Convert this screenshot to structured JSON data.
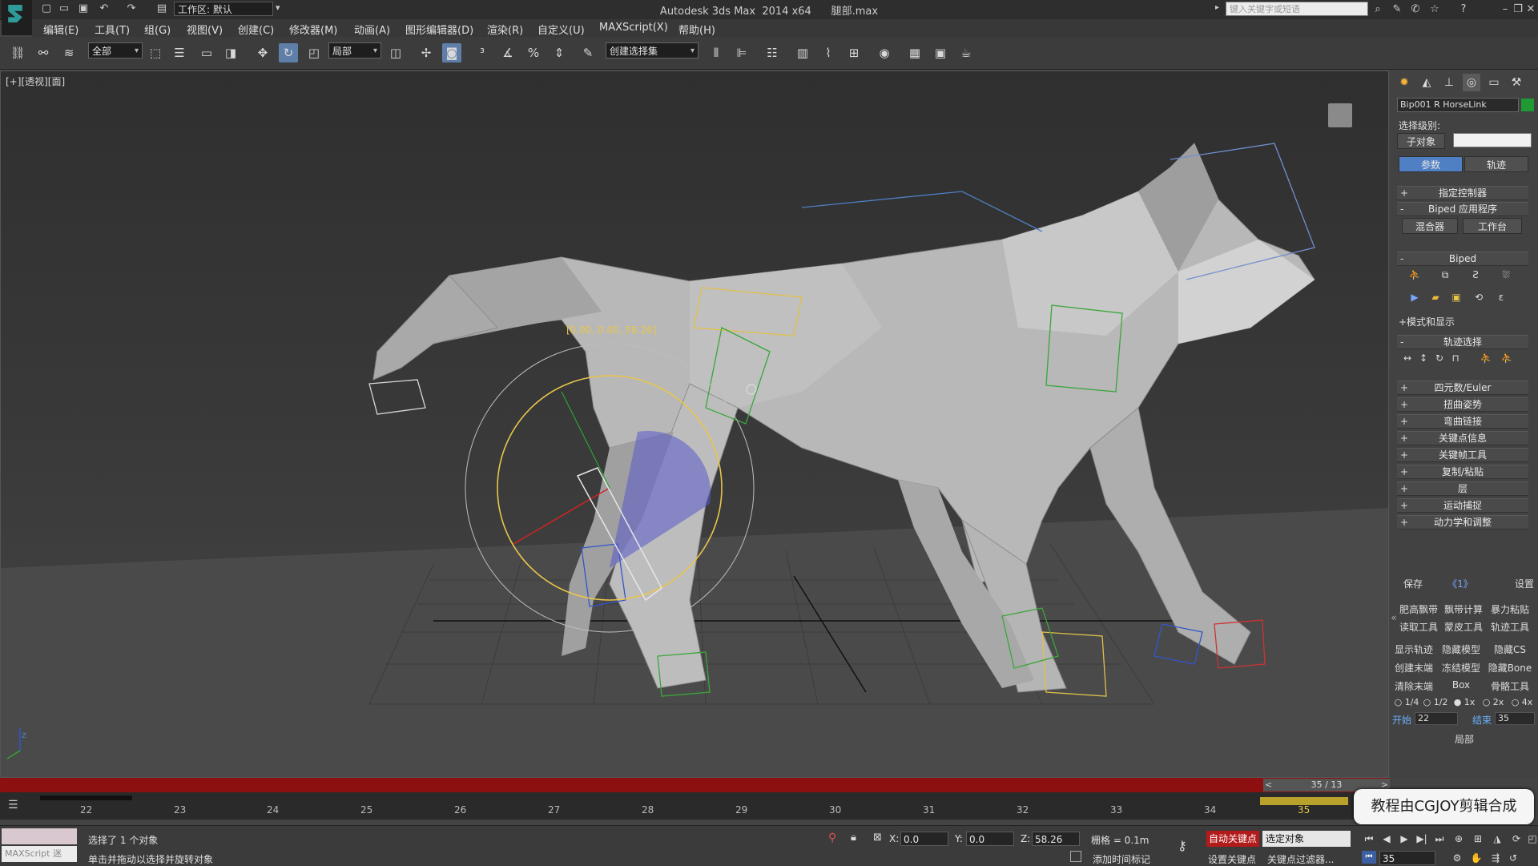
{
  "titlebar": {
    "workspace": "工作区: 默认",
    "window_title": "Autodesk 3ds Max  2014 x64      腿部.max",
    "search_placeholder": "键入关键字或短语"
  },
  "menu": [
    "编辑(E)",
    "工具(T)",
    "组(G)",
    "视图(V)",
    "创建(C)",
    "修改器(M)",
    "动画(A)",
    "图形编辑器(D)",
    "渲染(R)",
    "自定义(U)",
    "MAXScript(X)",
    "帮助(H)"
  ],
  "toolbar": {
    "selection_filter": "全部",
    "ref_coord": "局部",
    "named_selection": "创建选择集"
  },
  "viewport": {
    "label": "[+][透视][面]",
    "gizmo_readout": "[0.00, 0.00, 58.26]",
    "axis_z": "z"
  },
  "command_panel": {
    "object_name": "Bip001 R HorseLink",
    "selection_level_label": "选择级别:",
    "sub_object": "子对象",
    "tab_params": "参数",
    "tab_track": "轨迹",
    "rollouts_top": [
      "指定控制器",
      "Biped 应用程序"
    ],
    "mixer": "混合器",
    "workbench": "工作台",
    "biped_rollout": "Biped",
    "mode_display": "+模式和显示",
    "track_selection": "轨迹选择",
    "rollouts_bottom": [
      "四元数/Euler",
      "扭曲姿势",
      "弯曲链接",
      "关键点信息",
      "关键帧工具",
      "复制/粘贴",
      "层",
      "运动捕捉",
      "动力学和调整"
    ],
    "save": "保存",
    "page": "《1》",
    "settings": "设置",
    "grid_buttons": [
      [
        "肥高飘带",
        "飘带计算",
        "暴力粘贴"
      ],
      [
        "读取工具",
        "蒙皮工具",
        "轨迹工具"
      ],
      [
        "显示轨迹",
        "隐藏模型",
        "隐藏CS"
      ],
      [
        "创建末端",
        "冻结模型",
        "隐藏Bone"
      ],
      [
        "清除末端",
        "Box",
        "骨骼工具"
      ]
    ],
    "speed_options": [
      "1/4",
      "1/2",
      "1x",
      "2x",
      "4x"
    ],
    "start_label": "开始",
    "start_value": "22",
    "end_label": "结束",
    "end_value": "35",
    "local_label": "局部"
  },
  "timeline": {
    "slider": "35 / 13",
    "ticks": [
      "22",
      "23",
      "24",
      "25",
      "26",
      "27",
      "28",
      "29",
      "30",
      "31",
      "32",
      "33",
      "34",
      "35"
    ]
  },
  "watermark": "教程由CGJOY剪辑合成",
  "status": {
    "maxscript_label": "MAXScript 迷",
    "selected_text": "选择了 1 个对象",
    "prompt_text": "单击并拖动以选择并旋转对象",
    "x_label": "X:",
    "x_value": "0.0",
    "y_label": "Y:",
    "y_value": "0.0",
    "z_label": "Z:",
    "z_value": "58.26",
    "grid_text": "栅格 = 0.1m",
    "add_time_tag": "添加时间标记",
    "auto_key": "自动关键点",
    "selected_object": "选定对象",
    "set_key": "设置关键点",
    "key_filters": "关键点过滤器...",
    "current_frame": "35"
  },
  "colors": {
    "auto_key_red": "#b31a1a",
    "timeline_red": "#8c1010",
    "accent_blue": "#4f80c4",
    "gizmo_yellow": "#e8c64a"
  }
}
